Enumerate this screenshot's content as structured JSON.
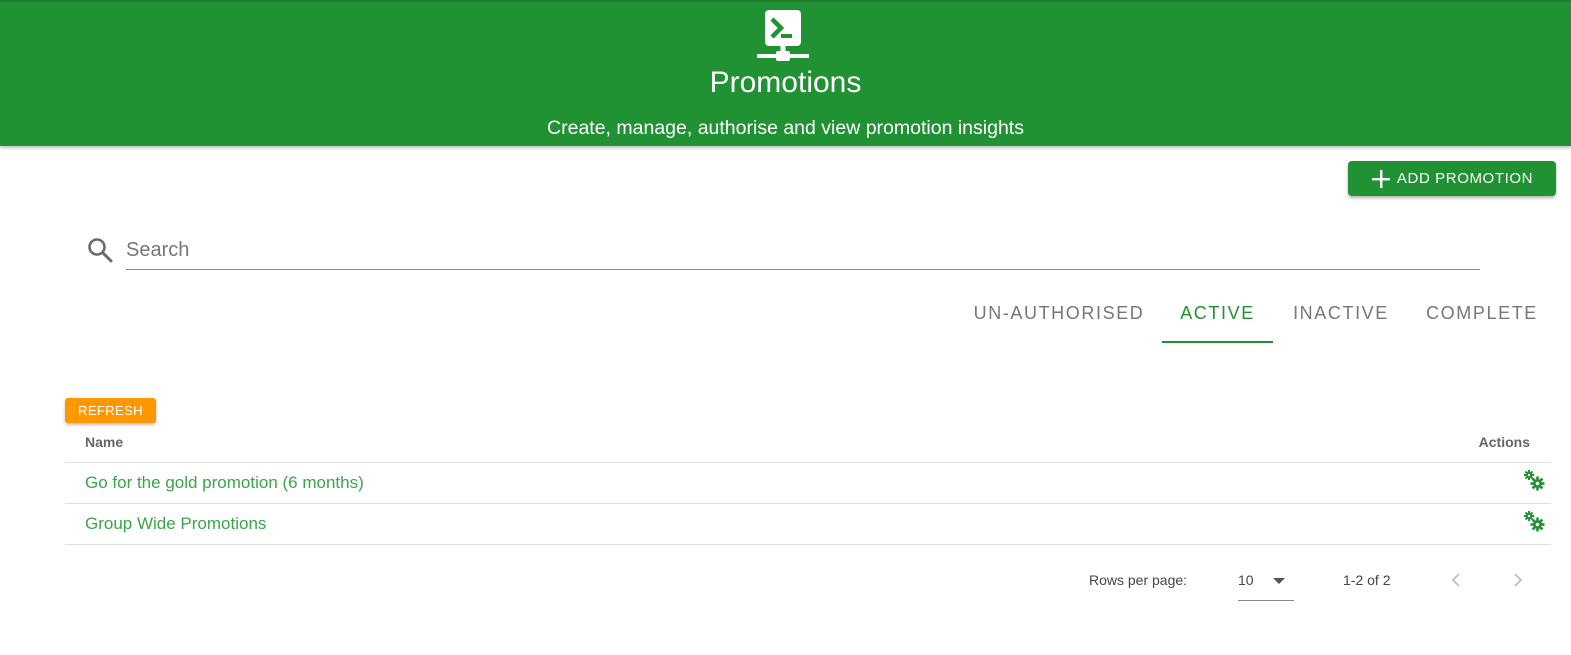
{
  "header": {
    "icon": "terminal-network-icon",
    "title": "Promotions",
    "subtitle": "Create, manage, authorise and view promotion insights",
    "background_color": "#219233"
  },
  "toolbar": {
    "add_icon": "plus-icon",
    "add_label": "ADD PROMOTION"
  },
  "search": {
    "icon": "search-icon",
    "placeholder": "Search",
    "value": ""
  },
  "tabs": [
    {
      "label": "UN-AUTHORISED",
      "active": false
    },
    {
      "label": "ACTIVE",
      "active": true
    },
    {
      "label": "INACTIVE",
      "active": false
    },
    {
      "label": "COMPLETE",
      "active": false
    }
  ],
  "refresh": {
    "label": "REFRESH",
    "color": "#ff9800"
  },
  "table": {
    "columns": [
      "Name",
      "Actions"
    ],
    "rows": [
      {
        "name": "Go for the gold promotion (6 months)",
        "action_icon": "cogs-icon"
      },
      {
        "name": "Group Wide Promotions",
        "action_icon": "cogs-icon"
      }
    ]
  },
  "pagination": {
    "rows_per_page_label": "Rows per page:",
    "rows_per_page": "10",
    "range": "1-2 of 2",
    "prev_icon": "chevron-left-icon",
    "next_icon": "chevron-right-icon"
  },
  "colors": {
    "accent": "#219233",
    "link": "#3aa648",
    "refresh": "#ff9800"
  }
}
